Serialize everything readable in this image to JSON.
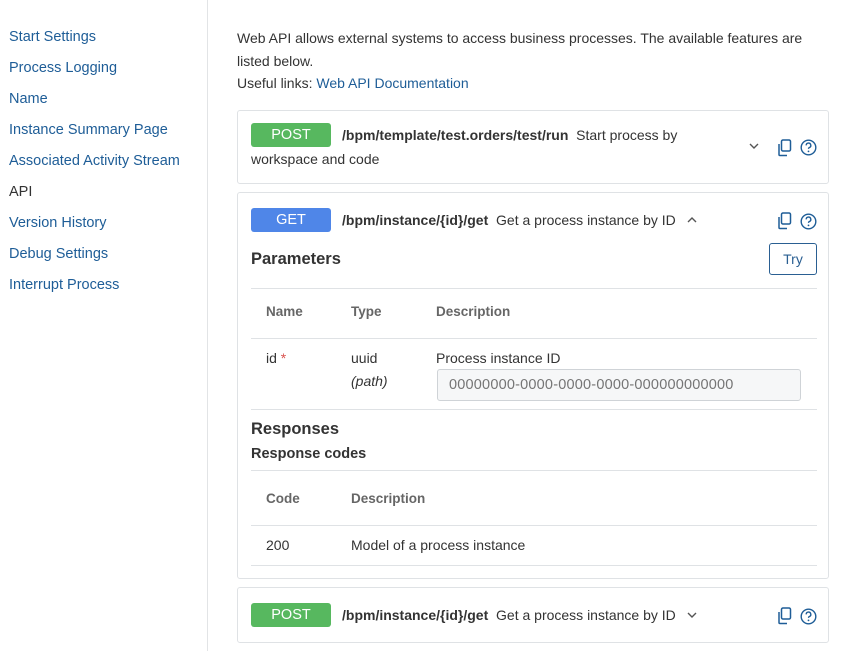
{
  "sidebar": {
    "items": [
      {
        "label": "Start Settings"
      },
      {
        "label": "Process Logging"
      },
      {
        "label": "Name"
      },
      {
        "label": "Instance Summary Page"
      },
      {
        "label": "Associated Activity Stream"
      },
      {
        "label": "API"
      },
      {
        "label": "Version History"
      },
      {
        "label": "Debug Settings"
      },
      {
        "label": "Interrupt Process"
      }
    ],
    "active": "API"
  },
  "intro": {
    "text": "Web API allows external systems to access business processes. The available features are listed below.",
    "links_label": "Useful links:",
    "doc_link": "Web API Documentation"
  },
  "endpoints": [
    {
      "method": "POST",
      "path": "/bpm/template/test.orders/test/run",
      "summary_start": "Start process by",
      "summary_end": "workspace and code",
      "expanded": false
    },
    {
      "method": "GET",
      "path": "/bpm/instance/{id}/get",
      "summary": "Get a process instance by ID",
      "expanded": true,
      "parameters": {
        "title": "Parameters",
        "try_label": "Try",
        "columns": [
          "Name",
          "Type",
          "Description"
        ],
        "rows": [
          {
            "name": "id",
            "required_mark": "*",
            "type": "uuid",
            "location": "(path)",
            "description": "Process instance ID",
            "placeholder": "00000000-0000-0000-0000-000000000000"
          }
        ]
      },
      "responses": {
        "title": "Responses",
        "codes_title": "Response codes",
        "columns": [
          "Code",
          "Description"
        ],
        "rows": [
          {
            "code": "200",
            "description": "Model of a process instance"
          }
        ]
      }
    },
    {
      "method": "POST",
      "path": "/bpm/instance/{id}/get",
      "summary": "Get a process instance by ID",
      "expanded": false
    }
  ],
  "colors": {
    "link": "#1e5d97",
    "post": "#57b85f",
    "get": "#4f86e8",
    "required": "#d9534f"
  },
  "icons": [
    "chevron-down-icon",
    "chevron-up-icon",
    "copy-icon",
    "help-icon"
  ]
}
